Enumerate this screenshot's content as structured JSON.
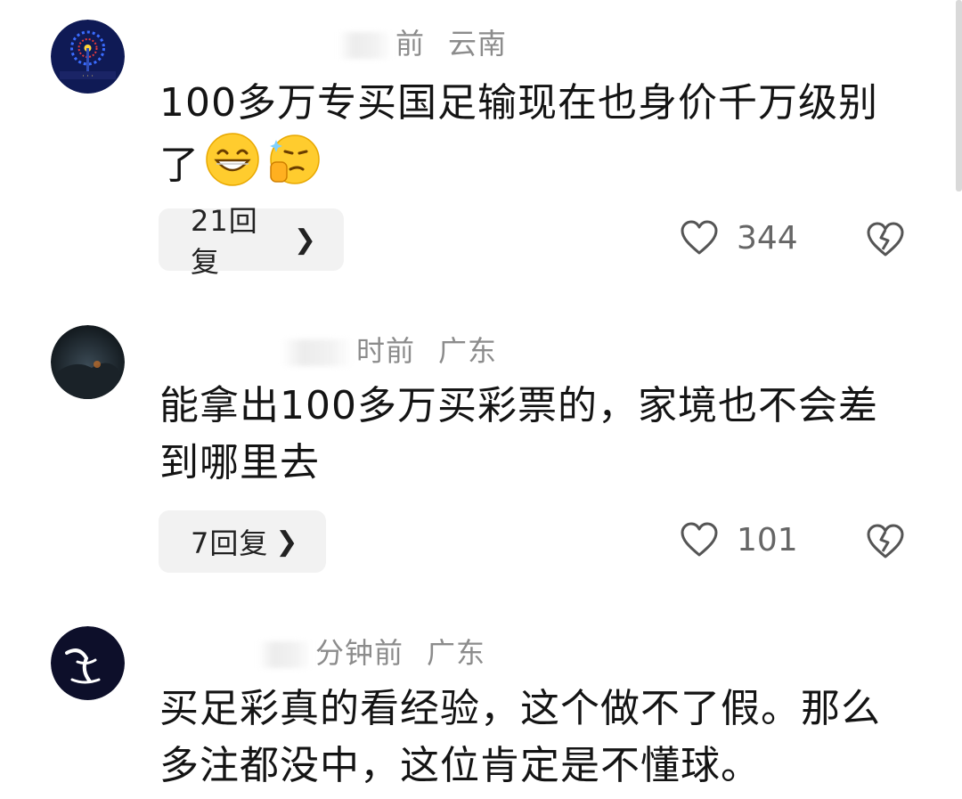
{
  "comments": [
    {
      "time": "前",
      "location": "云南",
      "text": "100多万专买国足输现在也身价千万级别了",
      "emojis": [
        "grinning-face-emoji",
        "thinking-thumbs-emoji"
      ],
      "reply_label": "21回复",
      "likes": "344"
    },
    {
      "time": "时前",
      "location": "广东",
      "text": "能拿出100多万买彩票的，家境也不会差到哪里去",
      "reply_label": "7回复",
      "likes": "101"
    },
    {
      "time": "分钟前",
      "location": "广东",
      "text": "买足彩真的看经验，这个做不了假。那么多注都没中，这位肯定是不懂球。"
    }
  ],
  "icons": {
    "reply_chevron": "chevron-right-icon",
    "like": "heart-outline-icon",
    "dislike": "broken-heart-icon"
  },
  "colors": {
    "meta_text": "#8c8c8c",
    "pill_bg": "#f2f2f2",
    "icon_stroke": "#555555"
  }
}
